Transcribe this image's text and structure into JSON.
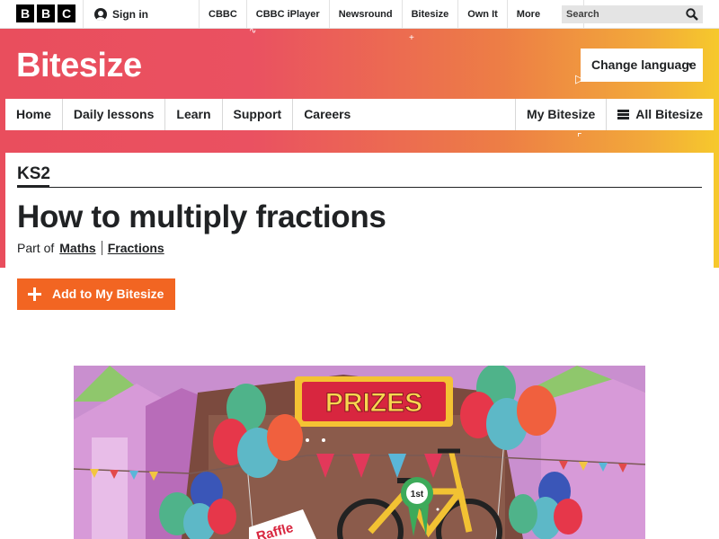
{
  "topbar": {
    "logo_letters": [
      "B",
      "B",
      "C"
    ],
    "signin_label": "Sign in",
    "nav_items": [
      "CBBC",
      "CBBC iPlayer",
      "Newsround",
      "Bitesize",
      "Own It"
    ],
    "more_label": "More",
    "search_placeholder": "Search"
  },
  "masthead": {
    "brand": "Bitesize",
    "language_button": "Change language",
    "nav": {
      "home": "Home",
      "daily_lessons": "Daily lessons",
      "learn": "Learn",
      "support": "Support",
      "careers": "Careers",
      "my_bitesize": "My Bitesize",
      "all_bitesize": "All Bitesize"
    }
  },
  "page": {
    "level": "KS2",
    "title": "How to multiply fractions",
    "part_of_label": "Part of",
    "breadcrumb": [
      "Maths",
      "Fractions"
    ],
    "add_button": "Add to My Bitesize"
  },
  "illustration": {
    "sign_text": "PRIZES",
    "rosette_text": "1st",
    "ticket_text": "Raffle"
  },
  "colors": {
    "accent_orange": "#f26522",
    "gradient_start": "#e94e5d",
    "gradient_end": "#f6c92c"
  }
}
